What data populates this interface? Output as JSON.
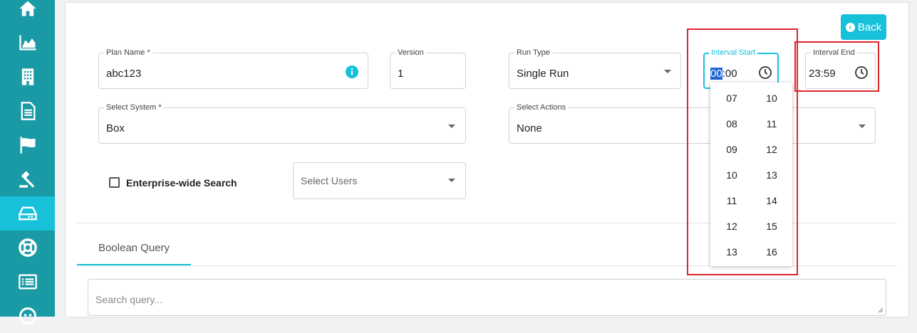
{
  "sidebar": {
    "items": [
      {
        "icon": "home-icon"
      },
      {
        "icon": "chart-icon"
      },
      {
        "icon": "building-icon"
      },
      {
        "icon": "document-icon"
      },
      {
        "icon": "flag-icon"
      },
      {
        "icon": "gavel-icon"
      },
      {
        "icon": "drive-icon",
        "active": true
      },
      {
        "icon": "lifebuoy-icon"
      },
      {
        "icon": "list-icon"
      },
      {
        "icon": "robot-icon"
      }
    ]
  },
  "colors": {
    "sidebar": "#1a9aa5",
    "accent": "#17c1da",
    "highlight": "#e0242b"
  },
  "header": {
    "back_label": "Back"
  },
  "form": {
    "plan_name": {
      "label": "Plan Name *",
      "value": "abc123"
    },
    "version": {
      "label": "Version",
      "value": "1"
    },
    "run_type": {
      "label": "Run Type",
      "value": "Single Run"
    },
    "interval_start": {
      "label": "Interval Start",
      "hour": "00",
      "minute": ":00"
    },
    "interval_end": {
      "label": "Interval End",
      "value": "23:59"
    },
    "select_system": {
      "label": "Select System *",
      "value": "Box"
    },
    "select_actions": {
      "label": "Select Actions",
      "value": "None"
    },
    "enterprise_search": {
      "label": "Enterprise-wide Search"
    },
    "select_users": {
      "placeholder": "Select Users"
    }
  },
  "time_dropdown": {
    "hours": [
      "07",
      "08",
      "09",
      "10",
      "11",
      "12",
      "13"
    ],
    "minutes": [
      "10",
      "11",
      "12",
      "13",
      "14",
      "15",
      "16"
    ]
  },
  "tabs": [
    {
      "label": "Boolean Query"
    }
  ],
  "search": {
    "placeholder": "Search query..."
  }
}
